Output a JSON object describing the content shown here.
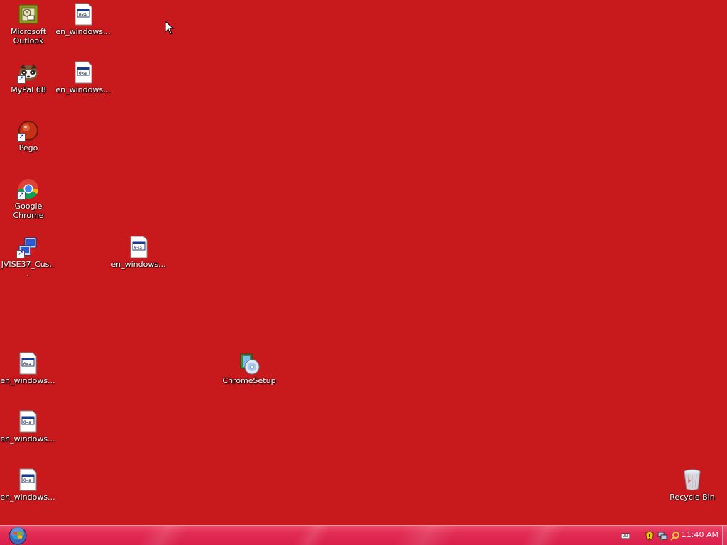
{
  "desktop": {
    "background_color": "#c8191d",
    "icons": [
      {
        "label": "Microsoft Outlook",
        "icon": "outlook-icon"
      },
      {
        "label": "en_windows...",
        "icon": "document-icon"
      },
      {
        "label": "MyPal 68",
        "icon": "mypal-browser-icon"
      },
      {
        "label": "en_windows...",
        "icon": "document-icon"
      },
      {
        "label": "Pego",
        "icon": "pego-icon"
      },
      {
        "label": "Google Chrome",
        "icon": "chrome-icon"
      },
      {
        "label": "JVISE37_Cus...",
        "icon": "installer-icon"
      },
      {
        "label": "en_windows...",
        "icon": "document-icon"
      },
      {
        "label": "en_windows...",
        "icon": "document-icon"
      },
      {
        "label": "ChromeSetup",
        "icon": "setup-icon"
      },
      {
        "label": "en_windows...",
        "icon": "document-icon"
      },
      {
        "label": "en_windows...",
        "icon": "document-icon"
      },
      {
        "label": "Recycle Bin",
        "icon": "recycle-bin-icon"
      }
    ]
  },
  "taskbar": {
    "start_icon": "windows-start-orb-icon",
    "tray_icons": [
      "keyboard-icon",
      "security-shield-icon",
      "network-icon",
      "search-icon"
    ],
    "clock": "11:40 AM"
  }
}
